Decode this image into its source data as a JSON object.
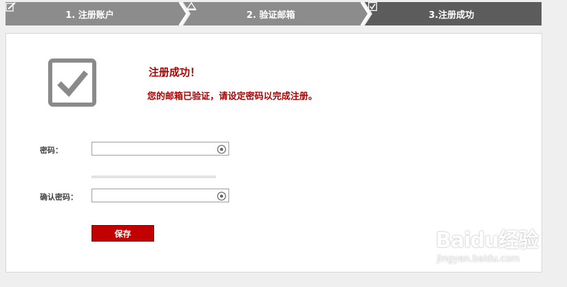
{
  "steps": [
    {
      "label": "1. 注册账户",
      "icon": "edit-icon",
      "state": "done"
    },
    {
      "label": "2. 验证邮箱",
      "icon": "mountain-icon",
      "state": "done"
    },
    {
      "label": "3.注册成功",
      "icon": "checkbox-icon",
      "state": "active"
    }
  ],
  "result": {
    "title": "注册成功！",
    "message": "您的邮箱已验证，请设定密码以完成注册。",
    "icon": "checkbox-checked-icon"
  },
  "form": {
    "password_label": "密码：",
    "password_value": "",
    "confirm_label": "确认密码：",
    "confirm_value": "",
    "save_label": "保存",
    "keyboard_icon": "virtual-keyboard-icon"
  },
  "watermark": {
    "brand": "Baidu经验",
    "url": "jingyan.baidu.com"
  },
  "colors": {
    "step_inactive": "#8c8c8c",
    "step_active": "#5c5c5c",
    "accent_red": "#b00000",
    "button_red": "#c20000"
  }
}
